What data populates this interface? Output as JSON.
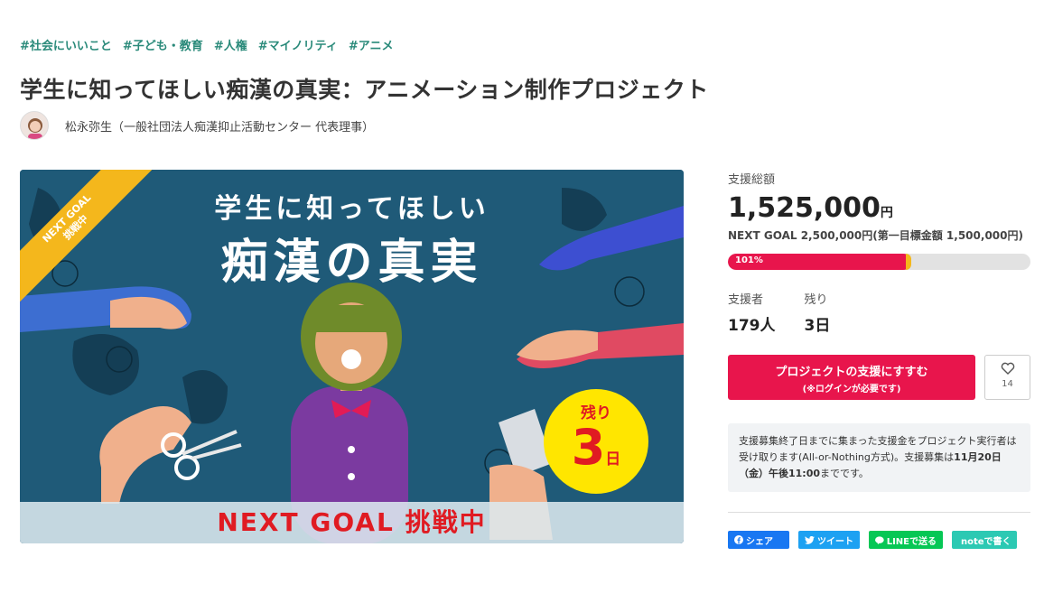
{
  "tags": [
    "#社会にいいこと",
    "#子ども・教育",
    "#人権",
    "#マイノリティ",
    "#アニメ"
  ],
  "title": "学生に知ってほしい痴漢の真実：アニメーション制作プロジェクト",
  "owner": {
    "name": "松永弥生（一般社団法人痴漢抑止活動センター 代表理事）"
  },
  "hero": {
    "heading_line1": "学生に知ってほしい",
    "heading_line2": "痴漢の真実",
    "ribbon_line1": "NEXT GOAL",
    "ribbon_line2": "挑戦中",
    "badge_top": "残り",
    "badge_number": "3",
    "badge_unit": "日",
    "band_text": "NEXT GOAL 挑戦中"
  },
  "stats": {
    "total_label": "支援総額",
    "total_amount": "1,525,000",
    "total_unit": "円",
    "goal_text": "NEXT GOAL 2,500,000円(第一目標金額 1,500,000円)",
    "progress_percent": 101,
    "progress_label": "101%",
    "supporters_label": "支援者",
    "supporters_value": "179人",
    "remaining_label": "残り",
    "remaining_value": "3日"
  },
  "cta": {
    "main": "プロジェクトの支援にすすむ",
    "sub": "(※ログインが必要です)",
    "favorite_count": "14"
  },
  "notice": {
    "text_plain": "支援募集終了日までに集まった支援金をプロジェクト実行者は受け取ります(All-or-Nothing方式)。支援募集は",
    "text_bold": "11月20日（金）午後11:00",
    "text_end": "までです。"
  },
  "share": {
    "facebook": "シェア",
    "twitter": "ツイート",
    "line": "LINEで送る",
    "note": "noteで書く"
  },
  "colors": {
    "accent": "#e8154c",
    "tag": "#2a8a7a",
    "hero_bg": "#1f5a78",
    "ribbon": "#f4b71c",
    "badge": "#ffe600"
  }
}
